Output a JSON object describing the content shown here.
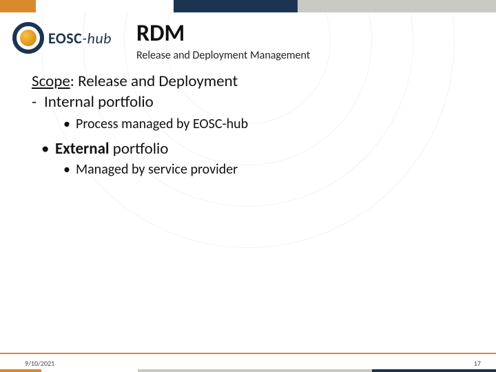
{
  "brand": {
    "name_main": "EOSC",
    "name_sub": "-hub"
  },
  "header": {
    "title": "RDM",
    "subtitle": "Release and Deployment Management"
  },
  "body": {
    "scope_label": "Scope",
    "scope_rest": ": Release and Deployment",
    "item1_dash": "-",
    "item1_text": "Internal portfolio",
    "item1_sub_dot": "•",
    "item1_sub_text": "Process managed by EOSC-hub",
    "item2_dot": "•",
    "item2_bold": "External",
    "item2_rest": " portfolio",
    "item2_sub_dot": "•",
    "item2_sub_text": "Managed by service provider"
  },
  "footer": {
    "date": "9/10/2021",
    "page": "17"
  }
}
